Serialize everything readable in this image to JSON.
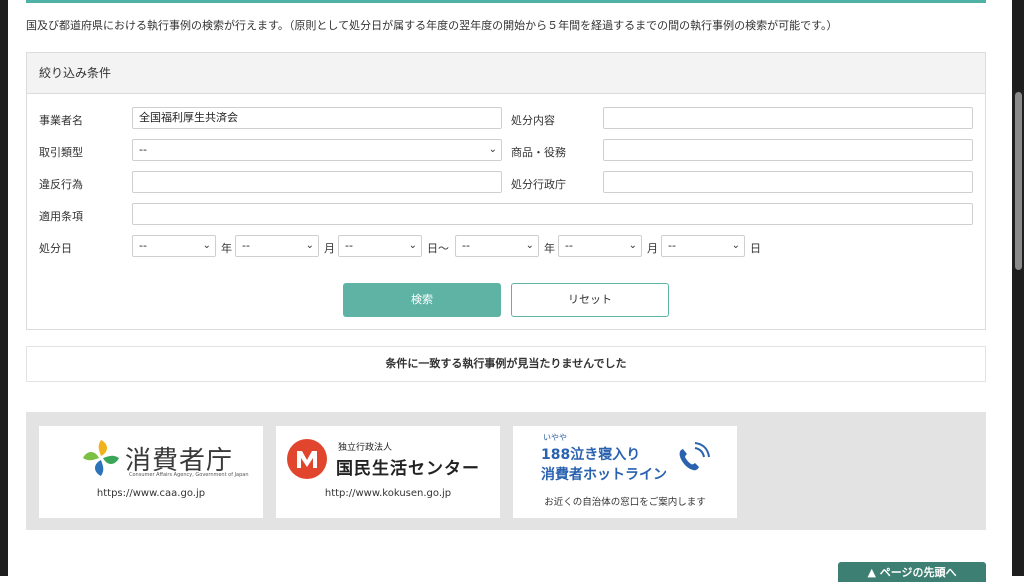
{
  "intro_text": "国及び都道府県における執行事例の検索が行えます。（原則として処分日が属する年度の翌年度の開始から５年間を経過するまでの間の執行事例の検索が可能です。）",
  "filter": {
    "title": "絞り込み条件",
    "labels": {
      "business_name": "事業者名",
      "disposition_content": "処分内容",
      "transaction_type": "取引類型",
      "product_service": "商品・役務",
      "violation": "違反行為",
      "disposition_agency": "処分行政庁",
      "applicable_clause": "適用条項",
      "disposition_date": "処分日"
    },
    "values": {
      "business_name": "全国福利厚生共済会",
      "disposition_content": "",
      "transaction_type": "--",
      "product_service": "",
      "violation": "",
      "disposition_agency": "",
      "applicable_clause": ""
    },
    "date": {
      "from_year": "--",
      "from_month": "--",
      "from_day": "--",
      "to_year": "--",
      "to_month": "--",
      "to_day": "--",
      "year_unit": "年",
      "month_unit": "月",
      "day_unit": "日",
      "range_sep": "日〜"
    },
    "search_label": "検索",
    "reset_label": "リセット"
  },
  "result_message": "条件に一致する執行事例が見当たりませんでした",
  "footer": {
    "caa": {
      "name": "消費者庁",
      "sub": "Consumer Affairs Agency, Government of Japan",
      "url": "https://www.caa.go.jp"
    },
    "kokusen": {
      "org_type": "独立行政法人",
      "name": "国民生活センター",
      "url": "http://www.kokusen.go.jp"
    },
    "hotline": {
      "ruby": "いやや",
      "line1": "188泣き寝入り",
      "line2": "消費者ホットライン",
      "desc": "お近くの自治体の窓口をご案内します"
    }
  },
  "page_top_label": "▲ ページの先頭へ",
  "colors": {
    "accent": "#5fb3a5",
    "hotline_blue": "#2a62b0",
    "kokusen_red": "#e2452e"
  }
}
